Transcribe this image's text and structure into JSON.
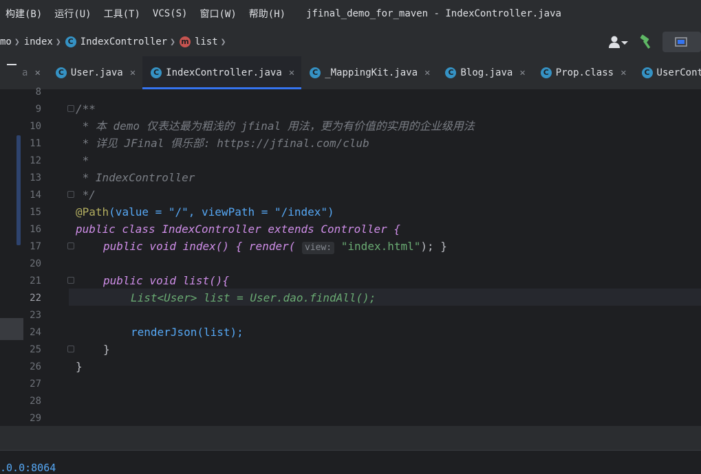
{
  "menubar": {
    "items": [
      "构建(B)",
      "运行(U)",
      "工具(T)",
      "VCS(S)",
      "窗口(W)",
      "帮助(H)"
    ],
    "title": "jfinal_demo_for_maven - IndexController.java"
  },
  "breadcrumb": {
    "items": [
      "mo",
      "index",
      "IndexController",
      "list"
    ]
  },
  "tabs": [
    {
      "label": "a",
      "active": false
    },
    {
      "label": "User.java",
      "active": false
    },
    {
      "label": "IndexController.java",
      "active": true
    },
    {
      "label": "_MappingKit.java",
      "active": false
    },
    {
      "label": "Blog.java",
      "active": false
    },
    {
      "label": "Prop.class",
      "active": false
    },
    {
      "label": "UserContro",
      "active": false
    }
  ],
  "editor": {
    "line_numbers": [
      "8",
      "9",
      "10",
      "11",
      "12",
      "13",
      "14",
      "15",
      "16",
      "17",
      "20",
      "21",
      "22",
      "23",
      "24",
      "25",
      "26",
      "27",
      "28",
      "29"
    ],
    "current_line": "22",
    "comment_start": "/**",
    "comment_line1": " * 本 demo 仅表达最为粗浅的 jfinal 用法，更为有价值的实用的企业级用法",
    "comment_line2": " * 详见 JFinal 俱乐部: https://jfinal.com/club",
    "comment_line3": " *",
    "comment_line4": " * IndexController",
    "comment_end": " */",
    "annotation": "@Path",
    "annotation_args": "(value = \"/\", viewPath = \"/index\")",
    "class_decl": "public class IndexController extends Controller {",
    "index_method": "public void index() { render(",
    "param_hint": "view:",
    "index_string": "\"index.html\"",
    "index_end": "); }",
    "list_method": "public void list(){",
    "list_body": "List<User> list = User.dao.findAll();",
    "render_json": "renderJson(list);",
    "close_method": "}",
    "close_class": "}"
  },
  "bottom": {
    "text": ".0.0:8064"
  }
}
